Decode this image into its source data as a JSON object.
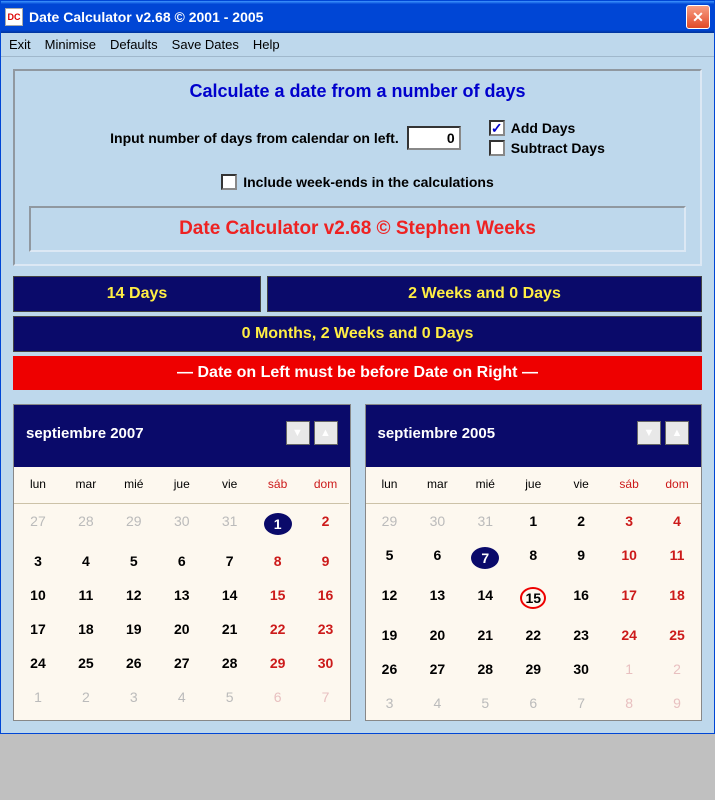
{
  "titlebar": {
    "text": "Date Calculator v2.68 © 2001 - 2005"
  },
  "menubar": [
    "Exit",
    "Minimise",
    "Defaults",
    "Save Dates",
    "Help"
  ],
  "panel": {
    "title": "Calculate a date from a number of days",
    "input_label": "Input number of days from calendar on left.",
    "days_value": "0",
    "add_label": "Add Days",
    "add_checked": "✓",
    "sub_label": "Subtract Days",
    "sub_checked": "",
    "weekend_label": "Include week-ends in the calculations",
    "weekend_checked": "",
    "credit": "Date Calculator v2.68 © Stephen Weeks"
  },
  "results": {
    "days": "14 Days",
    "weeks": "2 Weeks and 0 Days",
    "full": "0 Months, 2 Weeks and 0 Days"
  },
  "warning": "— Date on Left must be before Date on Right —",
  "dow": [
    "lun",
    "mar",
    "mié",
    "jue",
    "vie",
    "sáb",
    "dom"
  ],
  "calendars": {
    "left": {
      "month": "septiembre 2007",
      "days": [
        {
          "n": "27",
          "out": 1
        },
        {
          "n": "28",
          "out": 1
        },
        {
          "n": "29",
          "out": 1
        },
        {
          "n": "30",
          "out": 1
        },
        {
          "n": "31",
          "out": 1
        },
        {
          "n": "1",
          "we": 1,
          "sel": 1
        },
        {
          "n": "2",
          "we": 1
        },
        {
          "n": "3"
        },
        {
          "n": "4"
        },
        {
          "n": "5"
        },
        {
          "n": "6"
        },
        {
          "n": "7"
        },
        {
          "n": "8",
          "we": 1
        },
        {
          "n": "9",
          "we": 1
        },
        {
          "n": "10"
        },
        {
          "n": "11"
        },
        {
          "n": "12"
        },
        {
          "n": "13"
        },
        {
          "n": "14"
        },
        {
          "n": "15",
          "we": 1
        },
        {
          "n": "16",
          "we": 1
        },
        {
          "n": "17"
        },
        {
          "n": "18"
        },
        {
          "n": "19"
        },
        {
          "n": "20"
        },
        {
          "n": "21"
        },
        {
          "n": "22",
          "we": 1
        },
        {
          "n": "23",
          "we": 1
        },
        {
          "n": "24"
        },
        {
          "n": "25"
        },
        {
          "n": "26"
        },
        {
          "n": "27"
        },
        {
          "n": "28"
        },
        {
          "n": "29",
          "we": 1
        },
        {
          "n": "30",
          "we": 1
        },
        {
          "n": "1",
          "out": 1
        },
        {
          "n": "2",
          "out": 1
        },
        {
          "n": "3",
          "out": 1
        },
        {
          "n": "4",
          "out": 1
        },
        {
          "n": "5",
          "out": 1
        },
        {
          "n": "6",
          "out": 1,
          "we": 1
        },
        {
          "n": "7",
          "out": 1,
          "we": 1
        }
      ]
    },
    "right": {
      "month": "septiembre 2005",
      "days": [
        {
          "n": "29",
          "out": 1
        },
        {
          "n": "30",
          "out": 1
        },
        {
          "n": "31",
          "out": 1
        },
        {
          "n": "1"
        },
        {
          "n": "2"
        },
        {
          "n": "3",
          "we": 1
        },
        {
          "n": "4",
          "we": 1
        },
        {
          "n": "5"
        },
        {
          "n": "6"
        },
        {
          "n": "7",
          "sel": 1
        },
        {
          "n": "8"
        },
        {
          "n": "9"
        },
        {
          "n": "10",
          "we": 1
        },
        {
          "n": "11",
          "we": 1
        },
        {
          "n": "12"
        },
        {
          "n": "13"
        },
        {
          "n": "14"
        },
        {
          "n": "15",
          "circ": 1
        },
        {
          "n": "16"
        },
        {
          "n": "17",
          "we": 1
        },
        {
          "n": "18",
          "we": 1
        },
        {
          "n": "19"
        },
        {
          "n": "20"
        },
        {
          "n": "21"
        },
        {
          "n": "22"
        },
        {
          "n": "23"
        },
        {
          "n": "24",
          "we": 1
        },
        {
          "n": "25",
          "we": 1
        },
        {
          "n": "26"
        },
        {
          "n": "27"
        },
        {
          "n": "28"
        },
        {
          "n": "29"
        },
        {
          "n": "30"
        },
        {
          "n": "1",
          "out": 1,
          "we": 1
        },
        {
          "n": "2",
          "out": 1,
          "we": 1
        },
        {
          "n": "3",
          "out": 1
        },
        {
          "n": "4",
          "out": 1
        },
        {
          "n": "5",
          "out": 1
        },
        {
          "n": "6",
          "out": 1
        },
        {
          "n": "7",
          "out": 1
        },
        {
          "n": "8",
          "out": 1,
          "we": 1
        },
        {
          "n": "9",
          "out": 1,
          "we": 1
        }
      ]
    }
  }
}
